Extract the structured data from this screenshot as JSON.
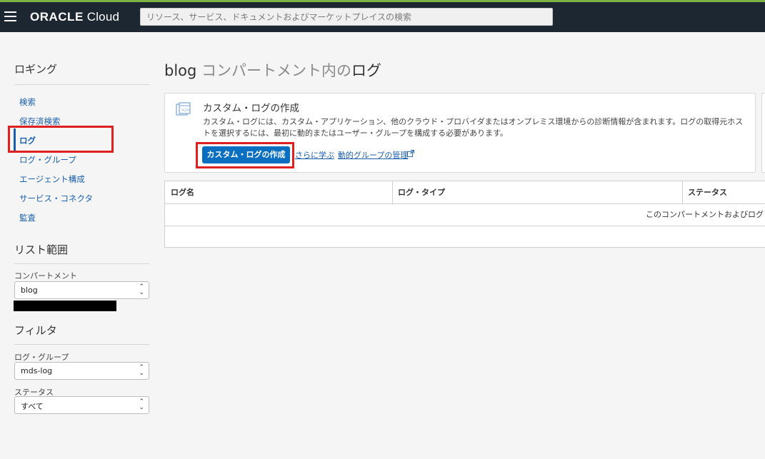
{
  "topbar": {
    "brand_oracle": "ORACLE",
    "brand_cloud": "Cloud",
    "search_placeholder": "リソース、サービス、ドキュメントおよびマーケットプレイスの検索"
  },
  "sidebar": {
    "title": "ロギング",
    "items": [
      {
        "label": "検索"
      },
      {
        "label": "保存済検索"
      },
      {
        "label": "ログ"
      },
      {
        "label": "ログ・グループ"
      },
      {
        "label": "エージェント構成"
      },
      {
        "label": "サービス・コネクタ"
      },
      {
        "label": "監査"
      }
    ],
    "scope": {
      "title": "リスト範囲",
      "compartment_label": "コンパートメント",
      "compartment_value": "blog"
    },
    "filters": {
      "title": "フィルタ",
      "log_group_label": "ログ・グループ",
      "log_group_value": "mds-log",
      "status_label": "ステータス",
      "status_value": "すべて"
    }
  },
  "main": {
    "title_compartment": "blog",
    "title_middle": " コンパートメント内の",
    "title_end": "ログ",
    "card": {
      "title": "カスタム・ログの作成",
      "description": "カスタム・ログには、カスタム・アプリケーション、他のクラウド・プロバイダまたはオンプレミス環境からの診断情報が含まれます。ログの取得元ホストを選択するには、最初に動的またはユーザー・グループを構成する必要があります。",
      "button": "カスタム・ログの作成",
      "learn_more": "さらに学ぶ",
      "dynamic_groups": "動的グループの管理"
    },
    "table": {
      "columns": [
        "ログ名",
        "ログ・タイプ",
        "ステータス"
      ],
      "empty_message": "このコンパートメントおよびログ・"
    }
  },
  "colors": {
    "topbar": "#1d2731",
    "accent_green": "#7cb342",
    "link_blue": "#1a5fad",
    "button_blue": "#0b6fc1",
    "highlight_red": "#e02020"
  }
}
